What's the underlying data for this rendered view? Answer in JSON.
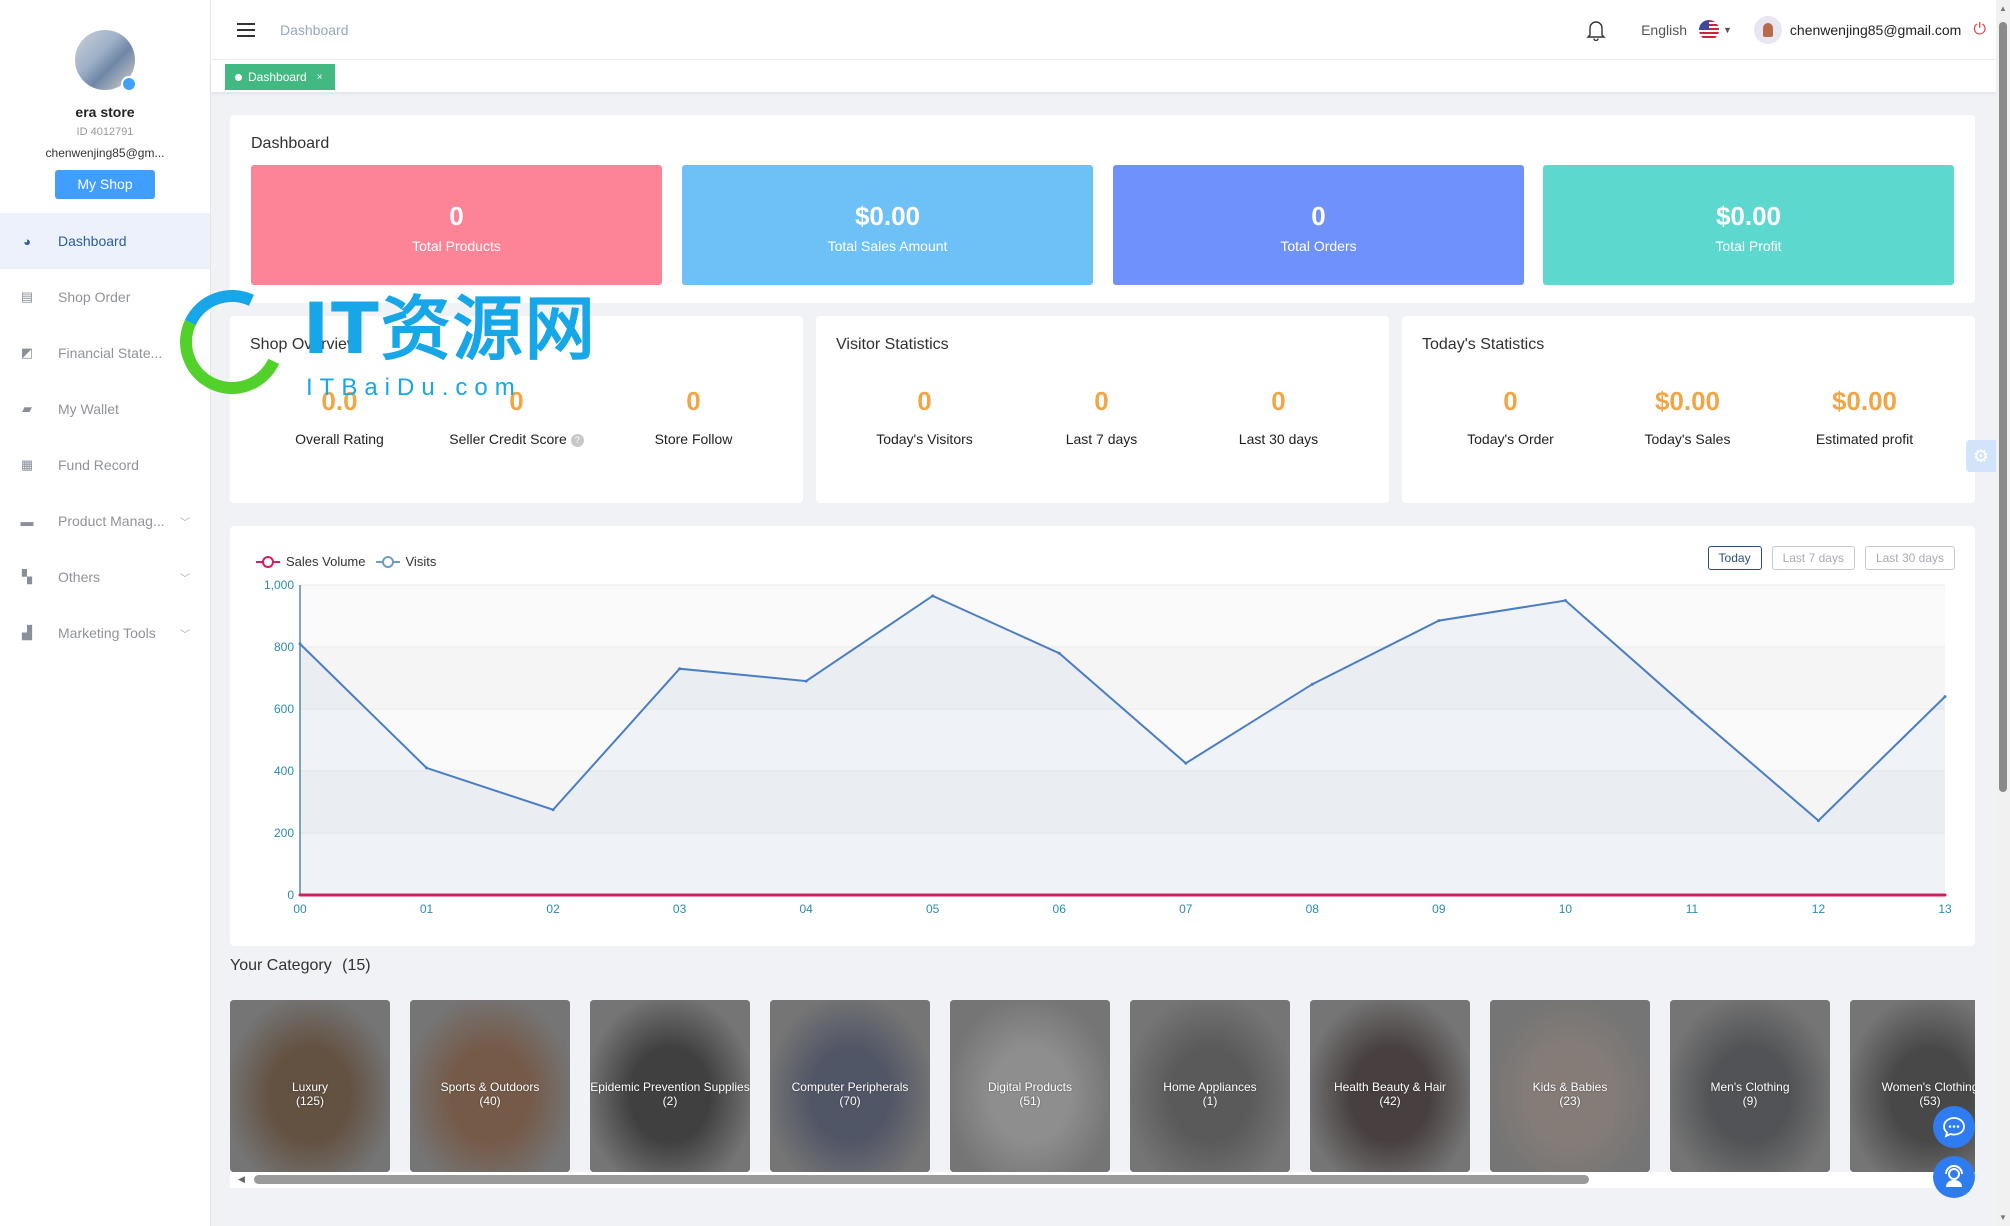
{
  "sidebar": {
    "store_name": "era store",
    "store_id": "ID 4012791",
    "email": "chenwenjing85@gm...",
    "my_shop_label": "My Shop",
    "items": [
      {
        "label": "Dashboard",
        "icon": "dashboard-gauge-icon",
        "active": true,
        "expandable": false
      },
      {
        "label": "Shop Order",
        "icon": "clipboard-icon",
        "active": false,
        "expandable": false
      },
      {
        "label": "Financial State...",
        "icon": "line-chart-icon",
        "active": false,
        "expandable": false
      },
      {
        "label": "My Wallet",
        "icon": "wallet-icon",
        "active": false,
        "expandable": false
      },
      {
        "label": "Fund Record",
        "icon": "document-icon",
        "active": false,
        "expandable": false
      },
      {
        "label": "Product Manag...",
        "icon": "briefcase-icon",
        "active": false,
        "expandable": true
      },
      {
        "label": "Others",
        "icon": "grid-icon",
        "active": false,
        "expandable": true
      },
      {
        "label": "Marketing Tools",
        "icon": "bar-chart-icon",
        "active": false,
        "expandable": true
      }
    ]
  },
  "header": {
    "breadcrumb": "Dashboard",
    "language": "English",
    "user_email": "chenwenjing85@gmail.com"
  },
  "tags": [
    {
      "label": "Dashboard",
      "close": "×"
    }
  ],
  "dashboard": {
    "title": "Dashboard",
    "cards": [
      {
        "value": "0",
        "label": "Total Products",
        "color": "#fd8497"
      },
      {
        "value": "$0.00",
        "label": "Total Sales Amount",
        "color": "#6ec1f7"
      },
      {
        "value": "0",
        "label": "Total Orders",
        "color": "#6e91fa"
      },
      {
        "value": "$0.00",
        "label": "Total Profit",
        "color": "#5dd8cf"
      }
    ]
  },
  "shop_overview": {
    "title": "Shop Overview",
    "items": [
      {
        "value": "0.0",
        "label": "Overall Rating"
      },
      {
        "value": "0",
        "label": "Seller Credit Score",
        "help": "?"
      },
      {
        "value": "0",
        "label": "Store Follow"
      }
    ]
  },
  "visitor_statistics": {
    "title": "Visitor Statistics",
    "items": [
      {
        "value": "0",
        "label": "Today's Visitors"
      },
      {
        "value": "0",
        "label": "Last 7 days"
      },
      {
        "value": "0",
        "label": "Last 30 days"
      }
    ]
  },
  "todays_statistics": {
    "title": "Today's Statistics",
    "items": [
      {
        "value": "0",
        "label": "Today's Order"
      },
      {
        "value": "$0.00",
        "label": "Today's Sales"
      },
      {
        "value": "$0.00",
        "label": "Estimated profit"
      }
    ]
  },
  "range_buttons": [
    {
      "label": "Today",
      "active": true
    },
    {
      "label": "Last 7 days",
      "active": false
    },
    {
      "label": "Last 30 days",
      "active": false
    }
  ],
  "chart_data": {
    "type": "line",
    "title": "",
    "xlabel": "",
    "ylabel": "",
    "x": [
      "00",
      "01",
      "02",
      "03",
      "04",
      "05",
      "06",
      "07",
      "08",
      "09",
      "10",
      "11",
      "12",
      "13"
    ],
    "ylim": [
      0,
      1000
    ],
    "yticks": [
      0,
      200,
      400,
      600,
      800,
      1000
    ],
    "ytick_labels": [
      "0",
      "200",
      "400",
      "600",
      "800",
      "1,000"
    ],
    "grid": true,
    "legend_position": "top-left",
    "series": [
      {
        "name": "Sales Volume",
        "color": "#d81b60",
        "values": [
          0,
          0,
          0,
          0,
          0,
          0,
          0,
          0,
          0,
          0,
          0,
          0,
          0,
          0
        ]
      },
      {
        "name": "Visits",
        "color": "#4a7ec2",
        "area": true,
        "values": [
          810,
          410,
          275,
          730,
          690,
          965,
          780,
          425,
          680,
          885,
          950,
          590,
          240,
          640
        ]
      }
    ]
  },
  "category": {
    "title": "Your Category",
    "count": "(15)",
    "items": [
      {
        "name": "Luxury",
        "count": "(125)",
        "tint": "#6b4a2e"
      },
      {
        "name": "Sports & Outdoors",
        "count": "(40)",
        "tint": "#8a5a3a"
      },
      {
        "name": "Epidemic Prevention Supplies",
        "count": "(2)",
        "tint": "#2a2a2a"
      },
      {
        "name": "Computer Peripherals",
        "count": "(70)",
        "tint": "#4a5370"
      },
      {
        "name": "Digital Products",
        "count": "(51)",
        "tint": "#b8b8b8"
      },
      {
        "name": "Home Appliances",
        "count": "(1)",
        "tint": "#5a5a5a"
      },
      {
        "name": "Health Beauty & Hair",
        "count": "(42)",
        "tint": "#3a2a2a"
      },
      {
        "name": "Kids & Babies",
        "count": "(23)",
        "tint": "#a89890"
      },
      {
        "name": "Men's Clothing",
        "count": "(9)",
        "tint": "#4a4d52"
      },
      {
        "name": "Women's Clothing",
        "count": "(53)",
        "tint": "#3a3a3a"
      }
    ]
  },
  "watermark": {
    "title": "IT资源网",
    "subtitle": "ITBaiDu.com"
  }
}
